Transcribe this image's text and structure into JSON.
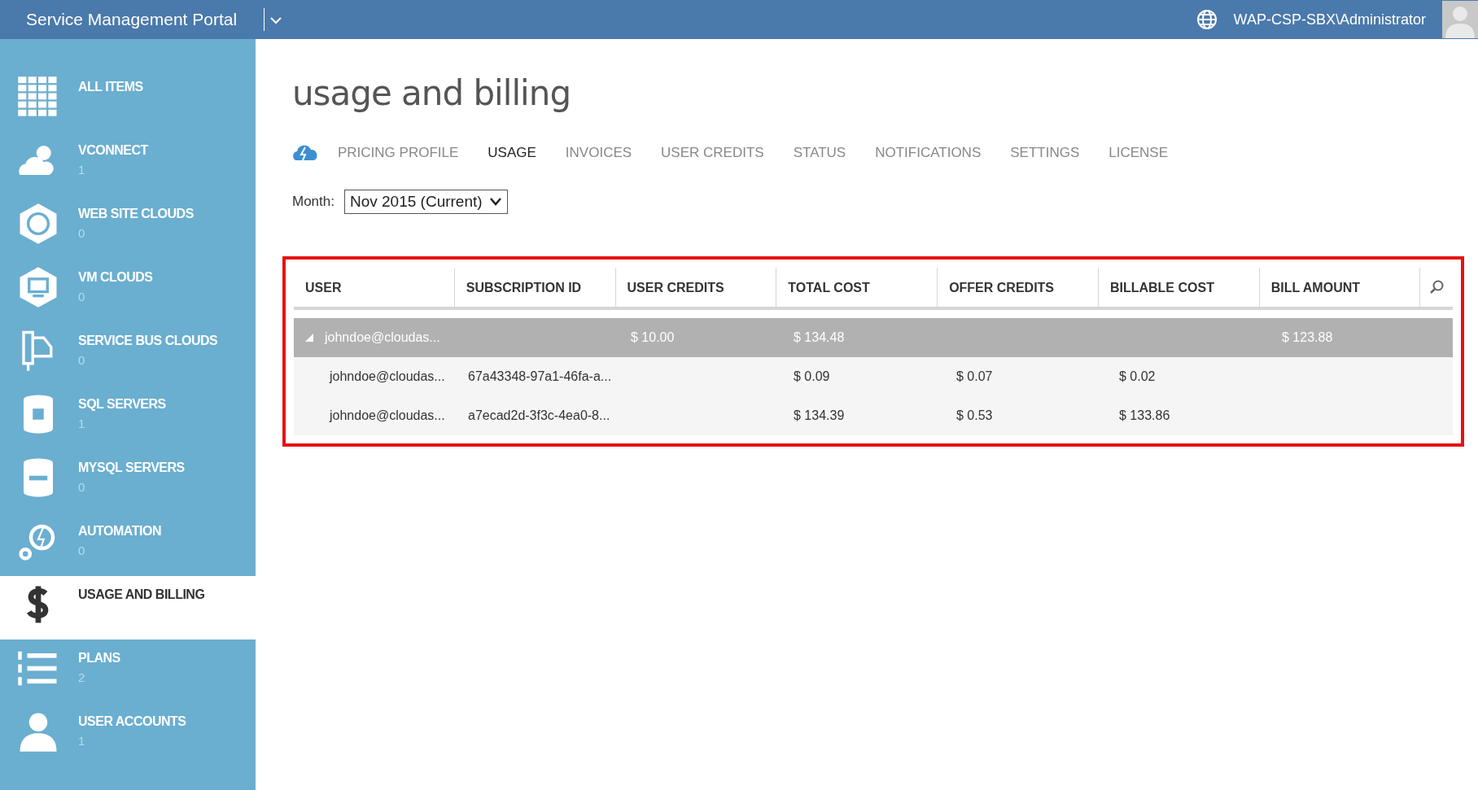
{
  "top_bar": {
    "title": "Service Management Portal",
    "user": "WAP-CSP-SBX\\Administrator"
  },
  "sidebar": {
    "items": [
      {
        "name": "ALL ITEMS",
        "selected": false
      },
      {
        "name": "VCONNECT",
        "count": "1",
        "selected": false
      },
      {
        "name": "WEB SITE CLOUDS",
        "count": "0",
        "selected": false
      },
      {
        "name": "VM CLOUDS",
        "count": "0",
        "selected": false
      },
      {
        "name": "SERVICE BUS CLOUDS",
        "count": "0",
        "selected": false
      },
      {
        "name": "SQL SERVERS",
        "count": "1",
        "selected": false
      },
      {
        "name": "MYSQL SERVERS",
        "count": "0",
        "selected": false
      },
      {
        "name": "AUTOMATION",
        "count": "0",
        "selected": false
      },
      {
        "name": "USAGE AND BILLING",
        "selected": true
      },
      {
        "name": "PLANS",
        "count": "2",
        "selected": false
      },
      {
        "name": "USER ACCOUNTS",
        "count": "1",
        "selected": false
      }
    ]
  },
  "page": {
    "title": "usage and billing",
    "tabs": [
      {
        "label": "PRICING PROFILE",
        "selected": false
      },
      {
        "label": "USAGE",
        "selected": true
      },
      {
        "label": "INVOICES",
        "selected": false
      },
      {
        "label": "USER CREDITS",
        "selected": false
      },
      {
        "label": "STATUS",
        "selected": false
      },
      {
        "label": "NOTIFICATIONS",
        "selected": false
      },
      {
        "label": "SETTINGS",
        "selected": false
      },
      {
        "label": "LICENSE",
        "selected": false
      }
    ],
    "month": {
      "label": "Month:",
      "value": "Nov 2015 (Current)"
    }
  },
  "table": {
    "columns": [
      "USER",
      "SUBSCRIPTION ID",
      "USER CREDITS",
      "TOTAL COST",
      "OFFER CREDITS",
      "BILLABLE COST",
      "BILL AMOUNT"
    ],
    "rows": [
      {
        "kind": "group",
        "expanded": true,
        "cells": [
          "johndoe@cloudas...",
          null,
          "$ 10.00",
          "$ 134.48",
          null,
          null,
          "$ 123.88"
        ]
      },
      {
        "kind": "detail",
        "cells": [
          "johndoe@cloudas...",
          "67a43348-97a1-46fa-a...",
          null,
          "$ 0.09",
          "$ 0.07",
          "$ 0.02",
          null
        ]
      },
      {
        "kind": "detail",
        "cells": [
          "johndoe@cloudas...",
          "a7ecad2d-3f3c-4ea0-8...",
          null,
          "$ 134.39",
          "$ 0.53",
          "$ 133.86",
          null
        ]
      }
    ]
  }
}
